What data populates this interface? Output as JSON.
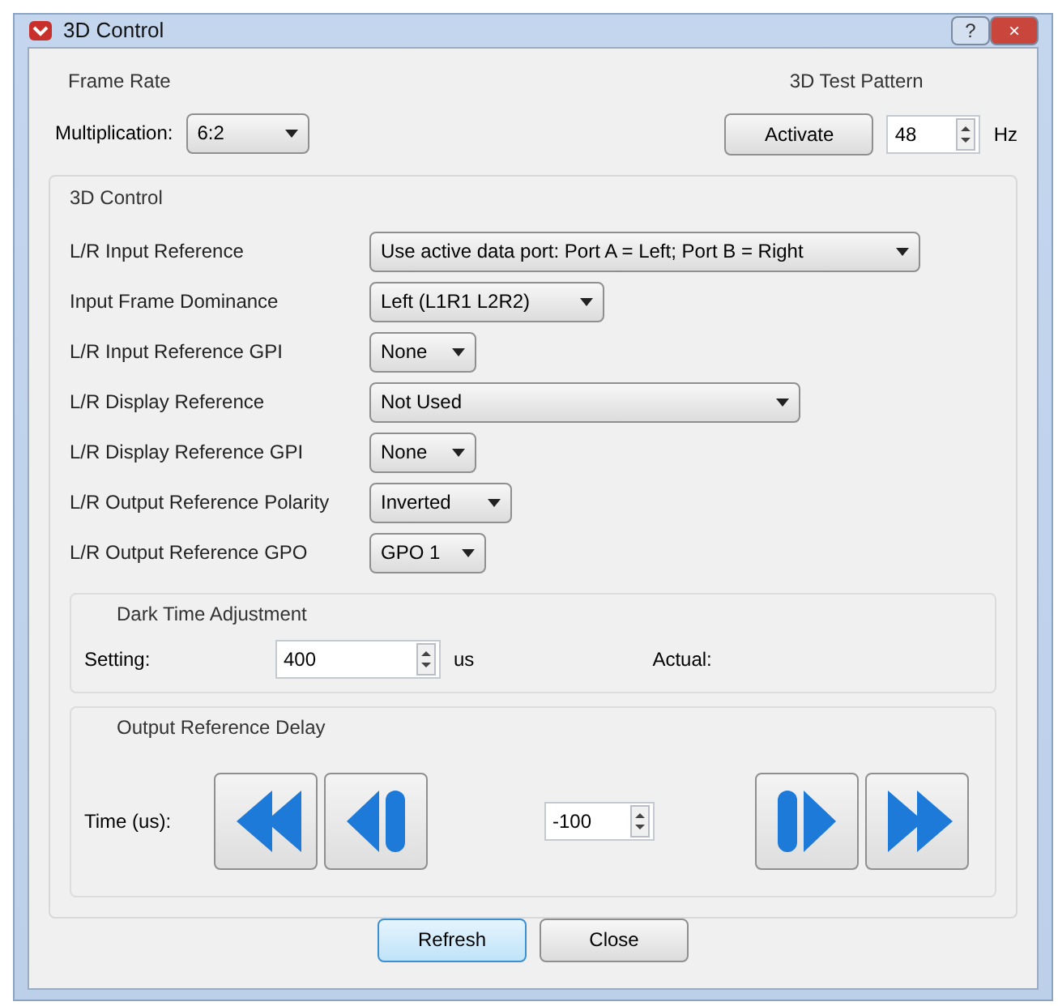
{
  "window": {
    "title": "3D Control",
    "buttons": [
      {
        "kind": "help",
        "label": "?"
      },
      {
        "kind": "close",
        "label": "×"
      }
    ]
  },
  "frame_rate": {
    "title": "Frame Rate",
    "label": "Multiplication:",
    "value": "6:2"
  },
  "test_pattern": {
    "title": "3D Test Pattern",
    "button": "Activate",
    "value": "48",
    "unit": "Hz"
  },
  "control": {
    "title": "3D Control",
    "rows": [
      {
        "label": "L/R Input Reference",
        "value": "Use active data port: Port A = Left; Port B = Right"
      },
      {
        "label": "Input Frame Dominance",
        "value": "Left (L1R1 L2R2)"
      },
      {
        "label": "L/R Input Reference GPI",
        "value": "None"
      },
      {
        "label": "L/R Display Reference",
        "value": "Not Used"
      },
      {
        "label": "L/R Display Reference GPI",
        "value": "None"
      },
      {
        "label": "L/R Output Reference Polarity",
        "value": "Inverted"
      },
      {
        "label": "L/R Output Reference GPO",
        "value": "GPO 1"
      }
    ],
    "dark_time": {
      "title": "Dark Time Adjustment",
      "label": "Setting:",
      "value": "400",
      "unit": "us",
      "actual_label": "Actual:"
    },
    "delay": {
      "title": "Output Reference Delay",
      "label": "Time (us):",
      "value": "-100",
      "buttons": [
        {
          "kind": "fast-back"
        },
        {
          "kind": "step-back"
        },
        {
          "kind": "step-forward"
        },
        {
          "kind": "fast-forward"
        }
      ]
    }
  },
  "footer": [
    {
      "label": "Refresh",
      "default": true
    },
    {
      "label": "Close",
      "default": false
    }
  ]
}
